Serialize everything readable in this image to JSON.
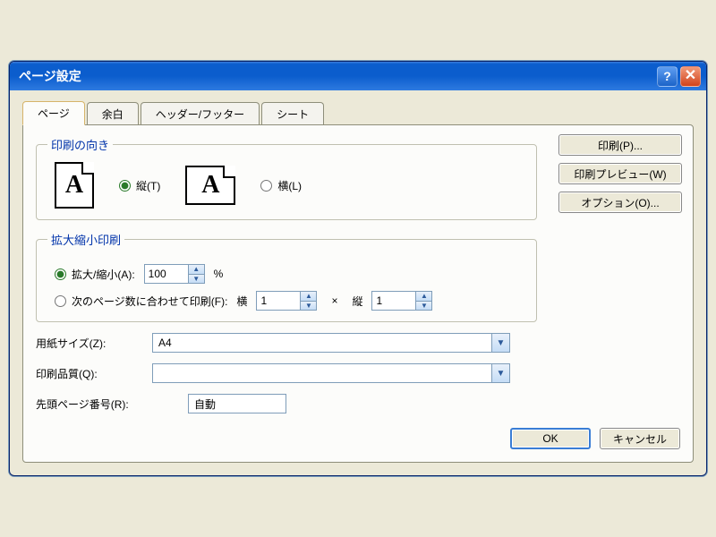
{
  "title": "ページ設定",
  "tabs": [
    {
      "label": "ページ",
      "active": true
    },
    {
      "label": "余白",
      "active": false
    },
    {
      "label": "ヘッダー/フッター",
      "active": false
    },
    {
      "label": "シート",
      "active": false
    }
  ],
  "groups": {
    "orientation": {
      "legend": "印刷の向き",
      "portrait_label": "縦(T)",
      "landscape_label": "横(L)"
    },
    "scaling": {
      "legend": "拡大縮小印刷",
      "adjust_label": "拡大/縮小(A):",
      "adjust_value": "100",
      "percent": "%",
      "fit_label": "次のページ数に合わせて印刷(F):",
      "fit_wide_label": "横",
      "fit_wide_value": "1",
      "fit_times": "×",
      "fit_tall_label": "縦",
      "fit_tall_value": "1"
    }
  },
  "fields": {
    "paper_size_label": "用紙サイズ(Z):",
    "paper_size_value": "A4",
    "quality_label": "印刷品質(Q):",
    "quality_value": "",
    "first_page_label": "先頭ページ番号(R):",
    "first_page_value": "自動"
  },
  "side_buttons": {
    "print": "印刷(P)...",
    "preview": "印刷プレビュー(W)",
    "options": "オプション(O)..."
  },
  "bottom": {
    "ok": "OK",
    "cancel": "キャンセル"
  }
}
